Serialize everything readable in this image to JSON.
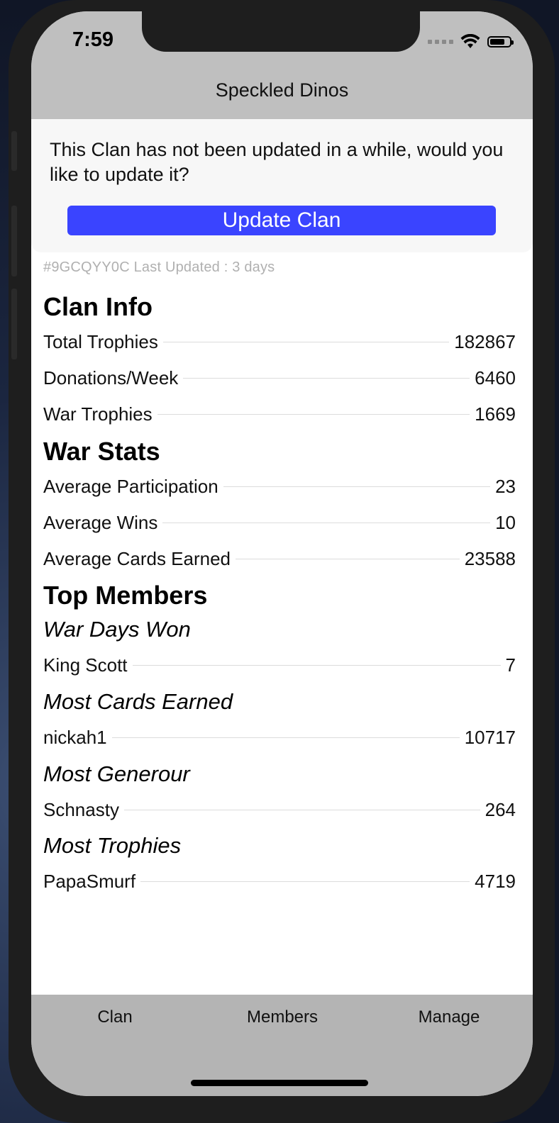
{
  "status_bar": {
    "time": "7:59"
  },
  "nav": {
    "title": "Speckled Dinos"
  },
  "banner": {
    "message": "This Clan has not been updated in a while, would you like to update it?",
    "button_label": "Update Clan"
  },
  "clan_meta": "#9GCQYY0C Last Updated : 3 days",
  "clan_info": {
    "title": "Clan Info",
    "rows": [
      {
        "label": "Total Trophies",
        "value": "182867"
      },
      {
        "label": "Donations/Week",
        "value": "6460"
      },
      {
        "label": "War Trophies",
        "value": "1669"
      }
    ]
  },
  "war_stats": {
    "title": "War Stats",
    "rows": [
      {
        "label": "Average Participation",
        "value": "23"
      },
      {
        "label": "Average Wins",
        "value": "10"
      },
      {
        "label": "Average Cards Earned",
        "value": "23588"
      }
    ]
  },
  "top_members": {
    "title": "Top Members",
    "groups": [
      {
        "heading": "War Days Won",
        "name": "King Scott",
        "value": "7"
      },
      {
        "heading": "Most Cards Earned",
        "name": "nickah1",
        "value": "10717"
      },
      {
        "heading": "Most Generour",
        "name": "Schnasty",
        "value": "264"
      },
      {
        "heading": "Most Trophies",
        "name": "PapaSmurf",
        "value": "4719"
      }
    ]
  },
  "tabs": [
    {
      "label": "Clan"
    },
    {
      "label": "Members"
    },
    {
      "label": "Manage"
    }
  ]
}
